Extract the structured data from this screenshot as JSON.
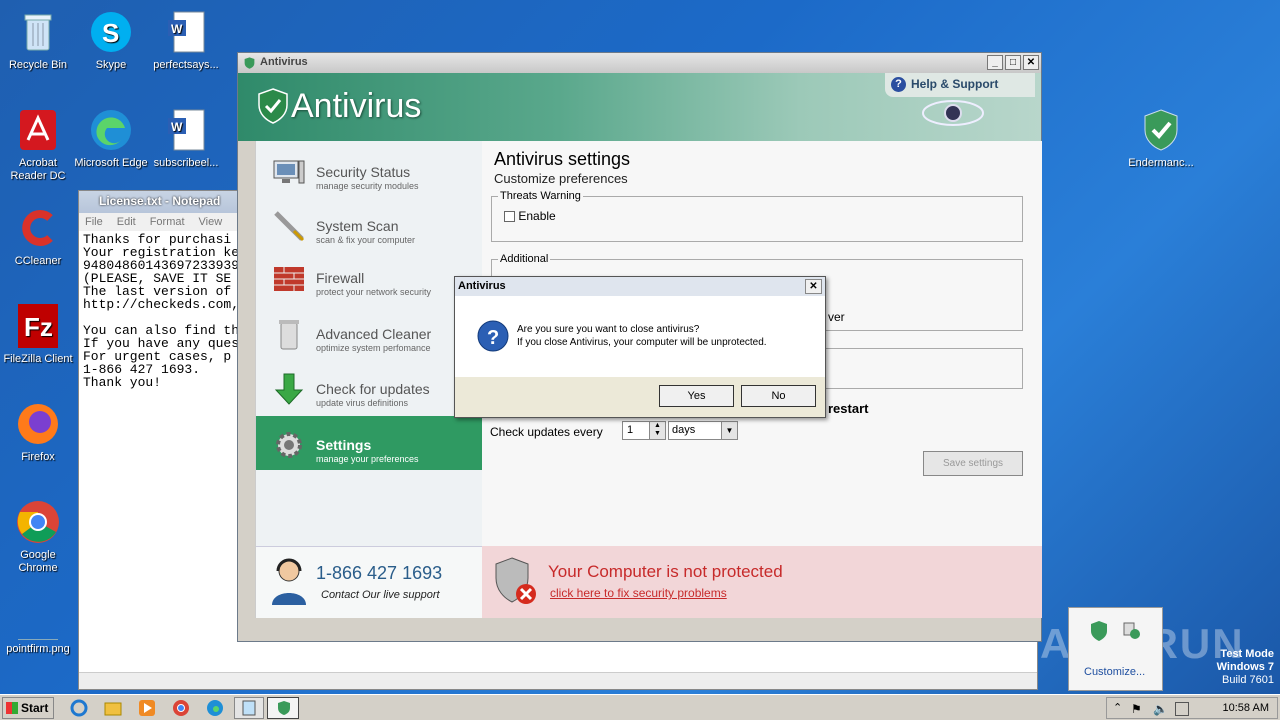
{
  "desktop": {
    "icons": [
      {
        "label": "Recycle Bin"
      },
      {
        "label": "Skype"
      },
      {
        "label": "perfectsays..."
      },
      {
        "label": "Acrobat Reader DC"
      },
      {
        "label": "Microsoft Edge"
      },
      {
        "label": "subscribeel..."
      },
      {
        "label": "CCleaner"
      },
      {
        "label": "FileZilla Client"
      },
      {
        "label": "Firefox"
      },
      {
        "label": "Google Chrome"
      },
      {
        "label": "pointfirm.png"
      },
      {
        "label": "Endermanc..."
      }
    ]
  },
  "notepad": {
    "title": "License.txt - Notepad",
    "menu": [
      "File",
      "Edit",
      "Format",
      "View",
      "He"
    ],
    "text": "Thanks for purchasi\nYour registration ke\n94804860143697233939\n(PLEASE, SAVE IT SE\nThe last version of\nhttp://checkeds.com,\n\nYou can also find th\nIf you have any ques\nFor urgent cases, p\n1-866 427 1693.\nThank you!"
  },
  "antivirus": {
    "window_title": "Antivirus",
    "logo": "Antivirus",
    "help": "Help & Support",
    "nav": [
      {
        "title": "Security Status",
        "sub": "manage security modules"
      },
      {
        "title": "System Scan",
        "sub": "scan & fix your computer"
      },
      {
        "title": "Firewall",
        "sub": "protect your network security"
      },
      {
        "title": "Advanced Cleaner",
        "sub": "optimize system perfomance"
      },
      {
        "title": "Check for updates",
        "sub": "update virus definitions"
      },
      {
        "title": "Settings",
        "sub": "manage your preferences"
      }
    ],
    "phone": "1-866 427 1693",
    "contact": "Contact Our live support",
    "settings": {
      "title": "Antivirus settings",
      "subtitle": "Customize preferences",
      "threats_legend": "Threats Warning",
      "enable_label": "Enable",
      "additional_legend": "Additional",
      "partial_text_1": "ver",
      "partial_text_2": "restart",
      "check_updates_label": "Check updates every",
      "check_updates_value": "1",
      "check_updates_unit": "days",
      "save_label": "Save settings"
    },
    "alert_title": "Your Computer is not protected",
    "alert_link": "click here to fix security problems"
  },
  "dialog": {
    "title": "Antivirus",
    "message1": "Are you sure you want to close antivirus?",
    "message2": "If you close Antivirus, your computer will be unprotected.",
    "yes": "Yes",
    "no": "No"
  },
  "taskbar": {
    "start": "Start",
    "clock": "10:58 AM"
  },
  "watermark": {
    "line1": "Test Mode",
    "line2": "Windows 7",
    "line3": "Build 7601"
  },
  "customize": "Customize...",
  "anyrun": "ANY RUN",
  "colors": {
    "accent": "#2f9a62",
    "alert": "#c72a2a",
    "desktop": "#1f66c0"
  }
}
